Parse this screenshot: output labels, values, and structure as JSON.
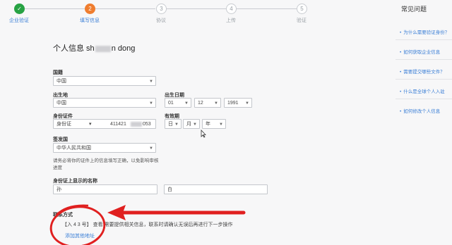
{
  "stepper": {
    "steps": [
      {
        "label": "企业验证",
        "state": "done"
      },
      {
        "label": "填写信息",
        "state": "active",
        "number": "2"
      },
      {
        "label": "协议",
        "state": "pending",
        "number": "3"
      },
      {
        "label": "上传",
        "state": "pending",
        "number": "4"
      },
      {
        "label": "验证",
        "state": "pending",
        "number": "5"
      }
    ]
  },
  "section": {
    "title_prefix": "个人信息 sh",
    "title_suffix": "n dong"
  },
  "form": {
    "country_label": "国籍",
    "country_value": "中国",
    "birthplace_label": "出生地",
    "birthplace_value": "中国",
    "birthdate_label": "出生日期",
    "birthdate_day": "01",
    "birthdate_month": "12",
    "birthdate_year": "1991",
    "id_label": "身份证件",
    "id_type": "身份证",
    "id_number_prefix": "411421",
    "id_number_suffix": "053",
    "expiry_label": "有效期",
    "expiry_day": "日",
    "expiry_month": "月",
    "expiry_year": "年",
    "issuer_label": "签发国",
    "issuer_value": "中华人民共和国",
    "hint": "请务必将你的证件上的信息填写正确，以免影响审核进度",
    "name_on_id_label": "身份证上显示的名称",
    "surname_value": "孙",
    "given_value": "白"
  },
  "footer": {
    "sub_label": "联系方式",
    "note": "【入 4 3 号】 查看 需要提供相关信息，联系时请确认无误后再进行下一步操作",
    "link": "添加其他地址"
  },
  "sidebar": {
    "title": "常见问题",
    "items": [
      "为什么需要验证身份？",
      "如何获取企业信息",
      "需要提交哪些文件？",
      "什么是全球个人入驻",
      "如何修改个人信息"
    ]
  },
  "colors": {
    "accent": "#3b7fd6",
    "done": "#27a243",
    "active": "#ef7d2f",
    "annotation": "#e02020"
  }
}
